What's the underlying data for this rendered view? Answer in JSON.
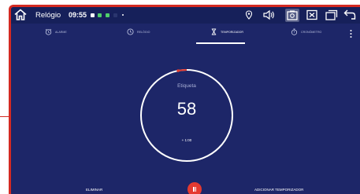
{
  "statusbar": {
    "app_title": "Relógio",
    "time": "09:55",
    "home_icon": "home-icon",
    "notification_icons": [
      "notification-icon-a",
      "notification-icon-b",
      "notification-icon-c",
      "notification-icon-d"
    ],
    "right_icons": [
      "location-icon",
      "volume-icon",
      "screenshot-icon",
      "close-box-icon",
      "recents-icon",
      "back-icon"
    ]
  },
  "tabs": [
    {
      "label": "ALARME",
      "icon": "alarm-icon",
      "active": false
    },
    {
      "label": "RELÓGIO",
      "icon": "clock-icon",
      "active": false
    },
    {
      "label": "TEMPORIZADOR",
      "icon": "hourglass-icon",
      "active": true
    },
    {
      "label": "CRONÓMETRO",
      "icon": "stopwatch-icon",
      "active": false
    }
  ],
  "timer": {
    "label": "Etiqueta",
    "value": "58",
    "add_label": "+ 1:00",
    "progress_fraction": 0.03
  },
  "actions": {
    "delete_label": "ELIMINAR",
    "add_timer_label": "ADICIONAR TEMPORIZADOR",
    "pause_icon": "pause-icon"
  },
  "colors": {
    "background": "#1d2668",
    "statusbar": "#16205a",
    "accent": "#e53a30",
    "frame": "#d42a22"
  }
}
